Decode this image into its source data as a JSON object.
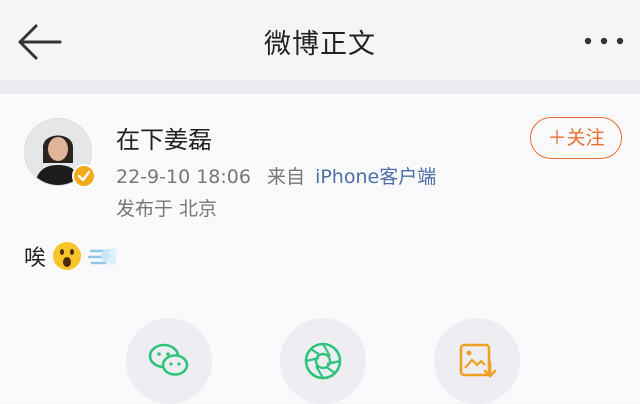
{
  "header": {
    "title": "微博正文",
    "back_icon": "arrow-left-icon",
    "more_icon": "more-dots-icon"
  },
  "post": {
    "author": "在下姜磊",
    "time": "22-9-10 18:06",
    "from_prefix": "来自",
    "source": "iPhone客户端",
    "location": "发布于 北京",
    "follow_label": "＋关注",
    "text": "唉",
    "emojis": [
      "surprised-face-emoji",
      "dash-emoji"
    ],
    "verified_badge_color": "#f4a91a"
  },
  "share_actions": [
    {
      "icon": "wechat-icon",
      "color": "#2ec27a"
    },
    {
      "icon": "moments-shutter-icon",
      "color": "#2ec27a"
    },
    {
      "icon": "save-image-icon",
      "color": "#f0a020"
    }
  ]
}
